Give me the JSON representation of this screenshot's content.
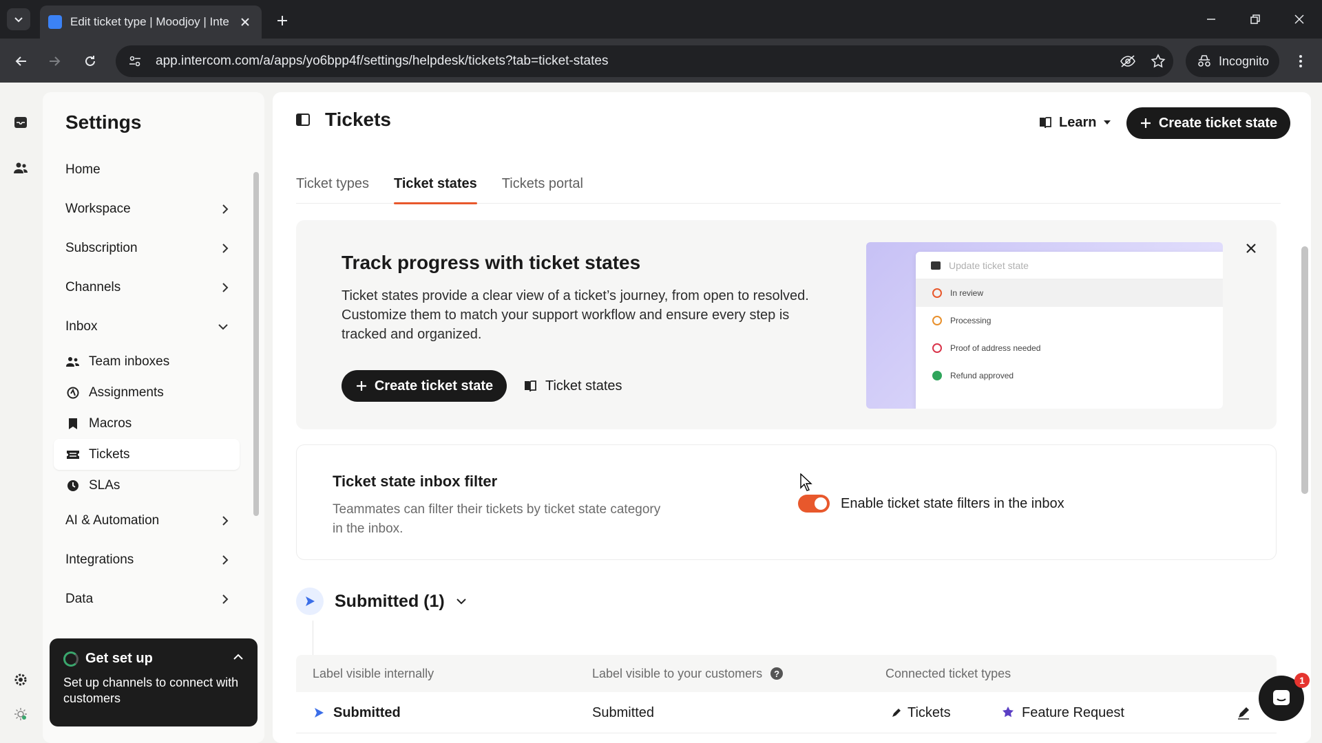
{
  "browser": {
    "tab_title": "Edit ticket type | Moodjoy | Inte",
    "url": "app.intercom.com/a/apps/yo6bpp4f/settings/helpdesk/tickets?tab=ticket-states",
    "incognito_label": "Incognito"
  },
  "settings": {
    "title": "Settings",
    "nav": [
      {
        "label": "Home"
      },
      {
        "label": "Workspace"
      },
      {
        "label": "Subscription"
      },
      {
        "label": "Channels"
      },
      {
        "label": "Inbox"
      }
    ],
    "inbox_items": [
      {
        "label": "Team inboxes",
        "icon": "team-icon"
      },
      {
        "label": "Assignments",
        "icon": "assignment-icon"
      },
      {
        "label": "Macros",
        "icon": "bookmark-icon"
      },
      {
        "label": "Tickets",
        "icon": "ticket-icon"
      },
      {
        "label": "SLAs",
        "icon": "clock-icon"
      }
    ],
    "nav_after": [
      {
        "label": "AI & Automation"
      },
      {
        "label": "Integrations"
      },
      {
        "label": "Data"
      }
    ]
  },
  "get_set_up": {
    "title": "Get set up",
    "body": "Set up channels to connect with customers"
  },
  "page": {
    "title": "Tickets",
    "learn_label": "Learn",
    "create_label": "Create ticket state",
    "tabs": [
      {
        "label": "Ticket types",
        "active": false
      },
      {
        "label": "Ticket states",
        "active": true
      },
      {
        "label": "Tickets portal",
        "active": false
      }
    ]
  },
  "promo": {
    "title": "Track progress with ticket states",
    "text": "Ticket states provide a clear view of a ticket’s journey, from open to resolved. Customize them to match your support workflow and ensure every step is tracked and organized.",
    "create_label": "Create ticket state",
    "link_label": "Ticket states",
    "illustration": {
      "placeholder": "Update ticket state",
      "states": [
        {
          "label": "In review",
          "color": "#e8582c"
        },
        {
          "label": "Processing",
          "color": "#e8902c"
        },
        {
          "label": "Proof of address needed",
          "color": "#d9344a"
        },
        {
          "label": "Refund approved",
          "color": "#2fa55b"
        }
      ]
    }
  },
  "filter": {
    "title": "Ticket state inbox filter",
    "text": "Teammates can filter their tickets by ticket state category in the inbox.",
    "toggle_label": "Enable ticket state filters in the inbox",
    "enabled": true
  },
  "group": {
    "title": "Submitted (1)",
    "columns": {
      "internal": "Label visible internally",
      "customers": "Label visible to your customers",
      "connected": "Connected ticket types",
      "help_glyph": "?"
    },
    "row": {
      "internal": "Submitted",
      "customers": "Submitted",
      "types": [
        "Tickets",
        "Feature Request"
      ]
    }
  },
  "messenger": {
    "badge": "1"
  },
  "colors": {
    "accent": "#e8582c",
    "dark": "#1a1a1a",
    "submitted_blue": "#3b6ee8"
  }
}
